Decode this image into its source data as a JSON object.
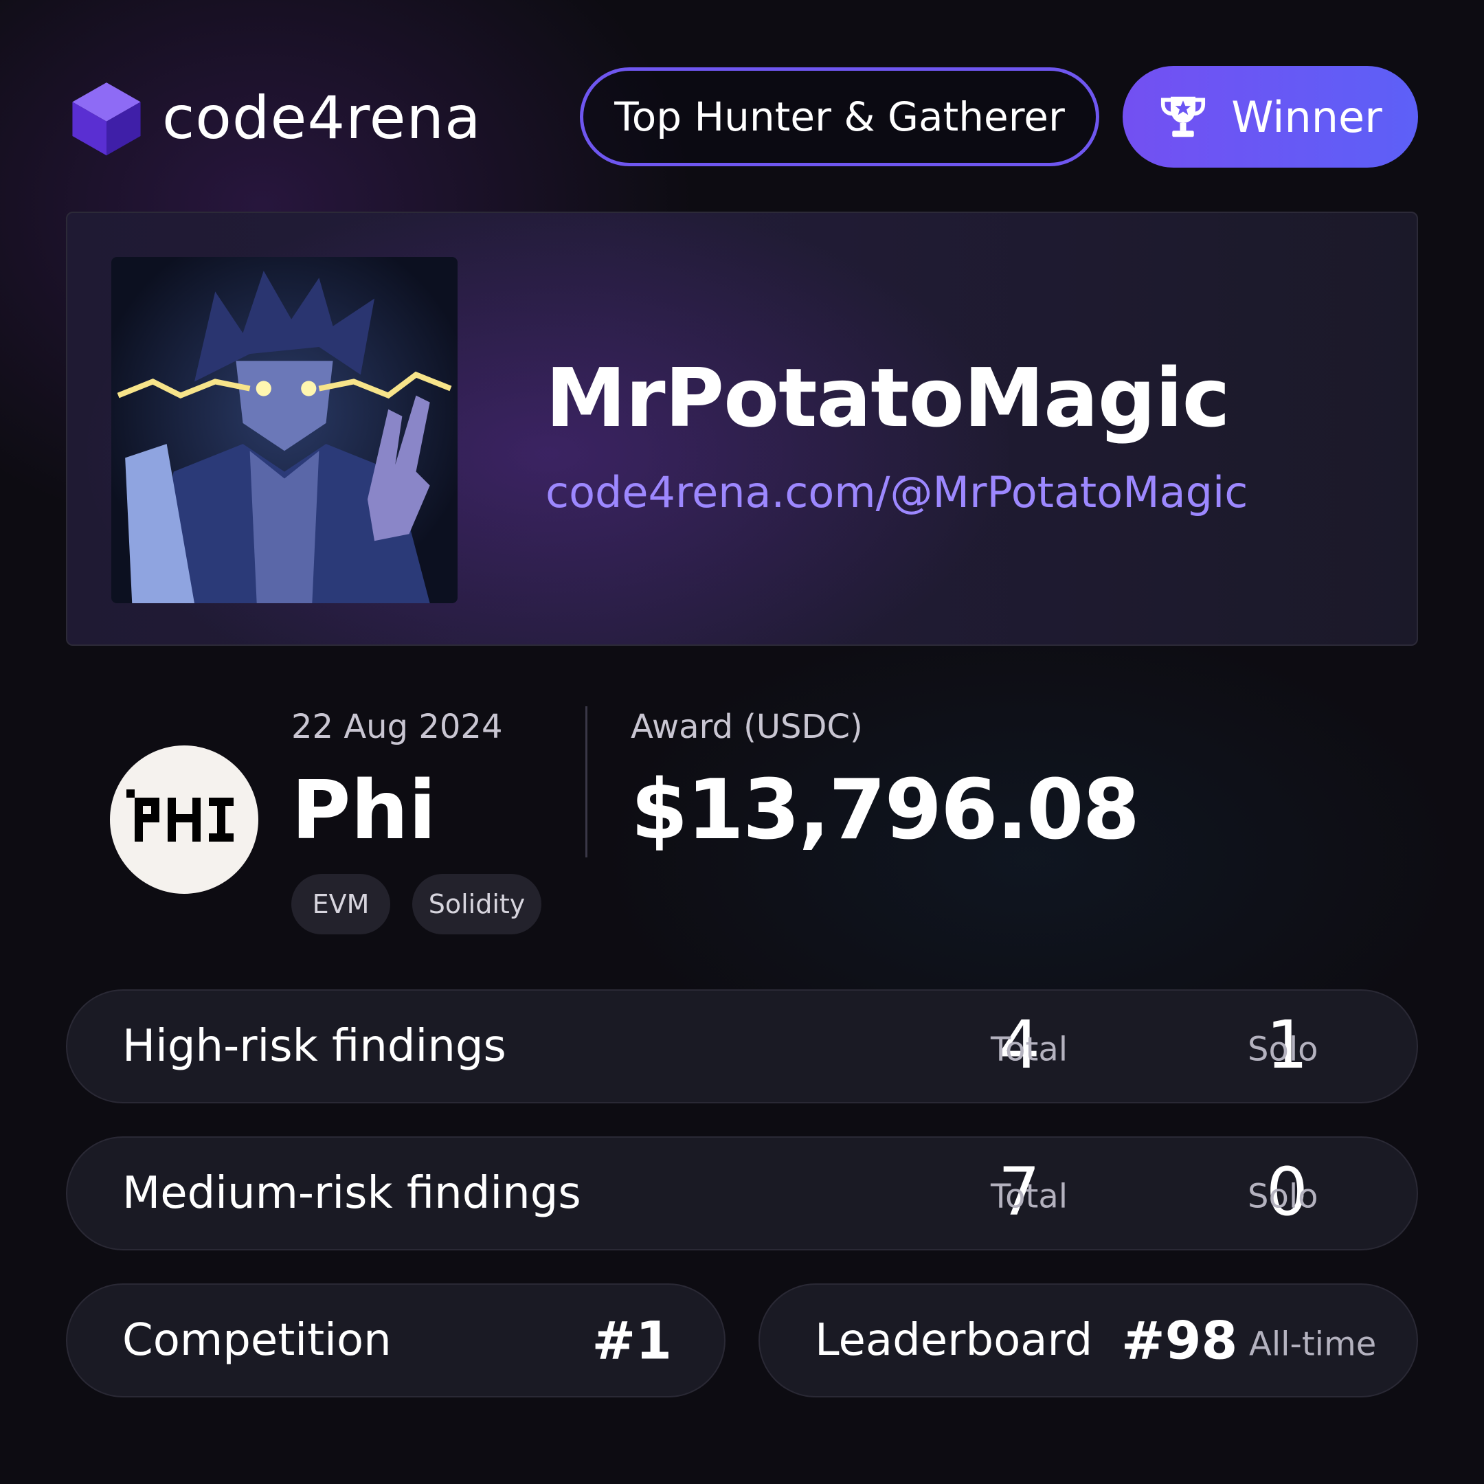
{
  "brand": {
    "name": "code4rena"
  },
  "badges": {
    "title": "Top Hunter & Gatherer",
    "winner": "Winner"
  },
  "profile": {
    "username": "MrPotatoMagic",
    "url": "code4rena.com/@MrPotatoMagic"
  },
  "contest": {
    "date": "22 Aug 2024",
    "name": "Phi",
    "logo_text": "PHI",
    "tags": [
      "EVM",
      "Solidity"
    ],
    "award_label": "Award (USDC)",
    "award_value": "$13,796.08"
  },
  "findings": [
    {
      "label": "High-risk findings",
      "total": "4",
      "total_label": "Total",
      "solo": "1",
      "solo_label": "Solo"
    },
    {
      "label": "Medium-risk findings",
      "total": "7",
      "total_label": "Total",
      "solo": "0",
      "solo_label": "Solo"
    }
  ],
  "ranks": {
    "competition": {
      "label": "Competition",
      "value": "#1"
    },
    "leaderboard": {
      "label": "Leaderboard",
      "value": "#98",
      "note": "All-time"
    }
  },
  "colors": {
    "accent": "#6f57f0",
    "winner_gradient_start": "#7350f2",
    "winner_gradient_end": "#5d60f7",
    "link": "#9d88ff",
    "background": "#0d0c12",
    "row_background": "#1a1a24"
  },
  "icons": {
    "logo": "cube-logo-icon",
    "winner": "trophy-icon",
    "avatar": "anime-avatar-image",
    "contest_logo": "phi-pixel-logo"
  }
}
